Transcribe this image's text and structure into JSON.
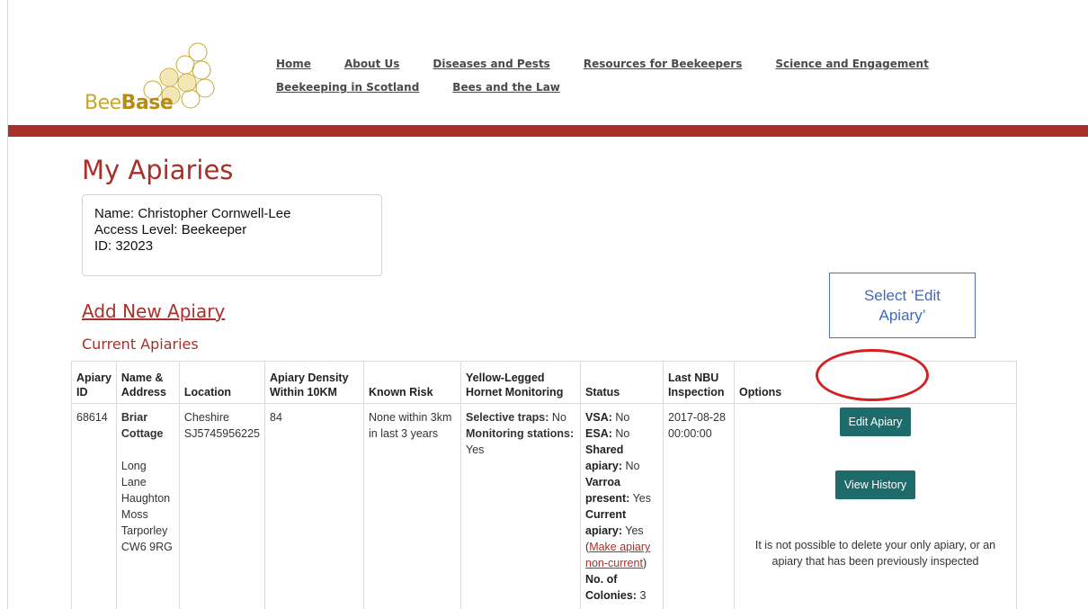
{
  "logo": {
    "text_prefix": "Bee",
    "text_bold": "Base"
  },
  "nav": {
    "row1": [
      "Home",
      "About Us",
      "Diseases and Pests",
      "Resources for Beekeepers",
      "Science and Engagement"
    ],
    "row2": [
      "Beekeeping in Scotland",
      "Bees and the Law"
    ]
  },
  "page": {
    "title": "My Apiaries",
    "user": {
      "name_line": "Name: Christopher Cornwell-Lee",
      "access_line": "Access Level: Beekeeper",
      "id_line": "ID: 32023"
    },
    "add_link": "Add New Apiary",
    "section_title": "Current Apiaries"
  },
  "annotation": {
    "callout_text": "Select ‘Edit Apiary’"
  },
  "table": {
    "headers": [
      "Apiary ID",
      "Name & Address",
      "Location",
      "Apiary Density Within 10KM",
      "Known Risk",
      "Yellow-Legged Hornet Monitoring",
      "Status",
      "Last NBU Inspection",
      "Options"
    ],
    "row": {
      "apiary_id": "68614",
      "name": "Briar Cottage",
      "address": [
        "Long Lane",
        "Haughton",
        "Moss",
        "Tarporley",
        "CW6 9RG"
      ],
      "location_county": "Cheshire",
      "location_grid": "SJ5745956225",
      "density": "84",
      "known_risk": "None within 3km in last 3 years",
      "hornet": {
        "selective_label": "Selective traps:",
        "selective_value": "No",
        "monitoring_label": "Monitoring stations:",
        "monitoring_value": "Yes"
      },
      "status": {
        "vsa_label": "VSA:",
        "vsa_value": "No",
        "esa_label": "ESA:",
        "esa_value": "No",
        "shared_label": "Shared apiary:",
        "shared_value": "No",
        "varroa_label": "Varroa present:",
        "varroa_value": "Yes",
        "current_label": "Current apiary:",
        "current_value": "Yes",
        "make_noncurrent_link": "Make apiary non-current",
        "colonies_label": "No. of Colonies:",
        "colonies_value": "3"
      },
      "last_inspection": "2017-08-28 00:00:00",
      "options": {
        "edit_button": "Edit Apiary",
        "history_button": "View History",
        "delete_note": "It is not possible to delete your only apiary, or an apiary that has been previously inspected"
      }
    }
  },
  "colors": {
    "brand_red": "#a8302a",
    "button_teal": "#1e6b6b",
    "risk_green": "#2e8b2e",
    "annotation_blue": "#4a72c4",
    "annotation_red": "#d62020"
  }
}
